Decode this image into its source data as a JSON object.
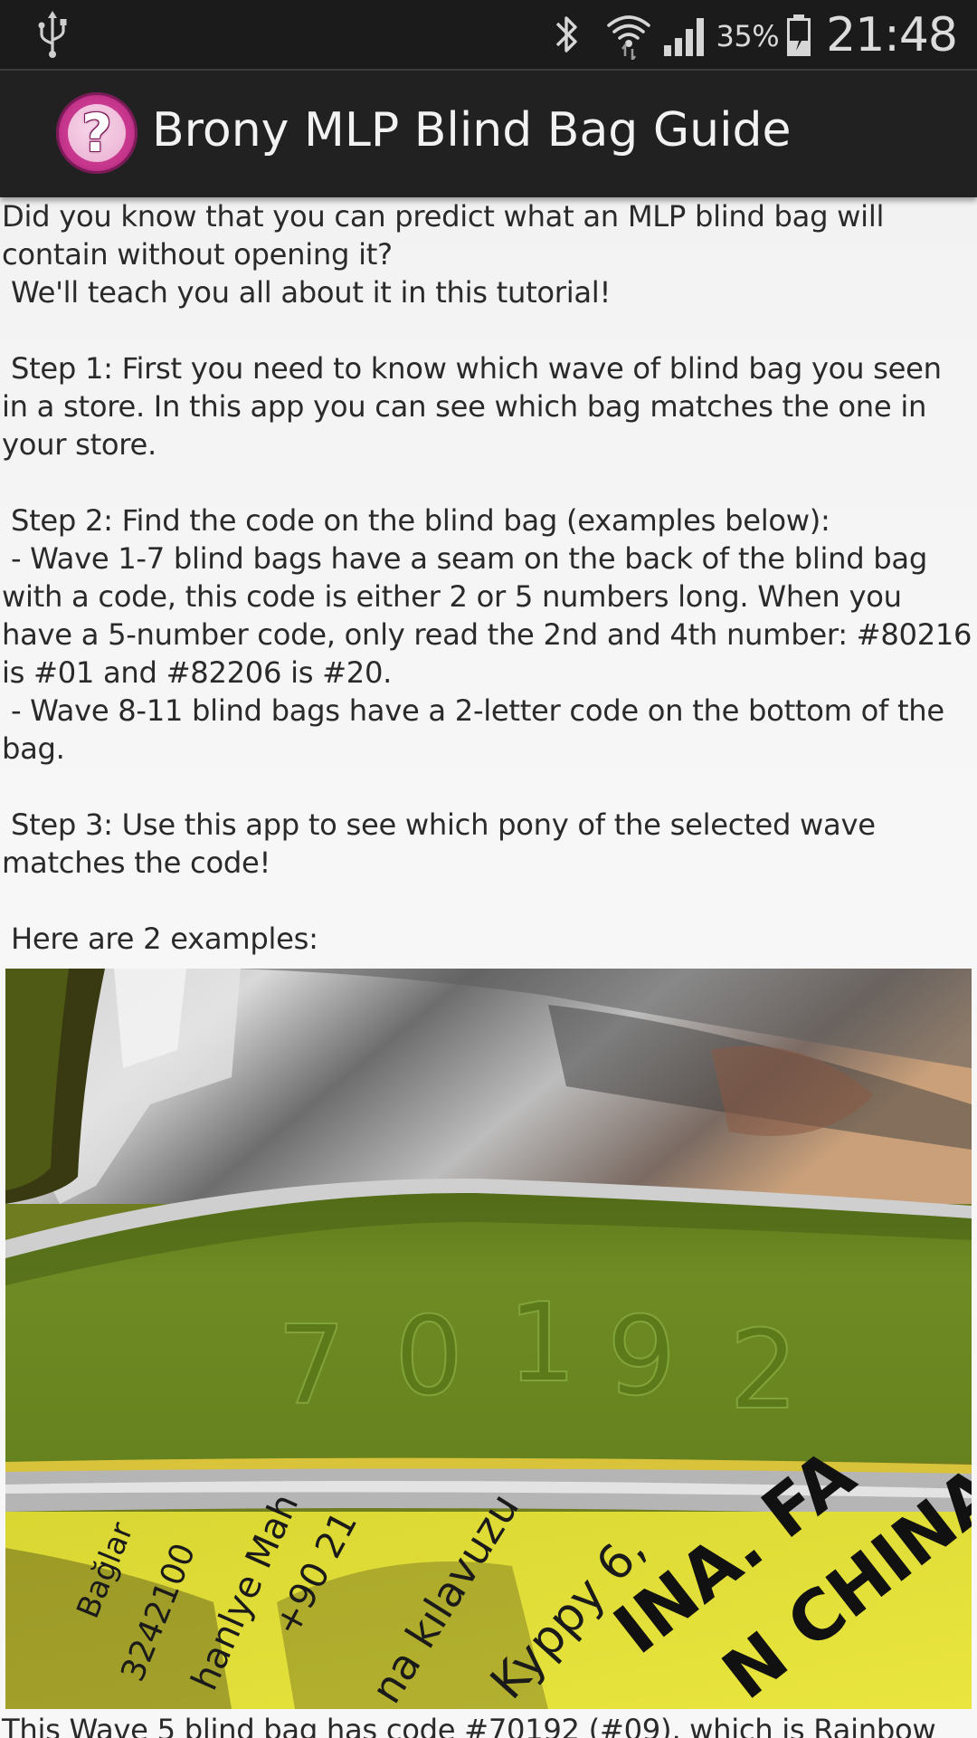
{
  "status_bar": {
    "icons": [
      "usb-icon",
      "bluetooth-icon",
      "wifi-icon",
      "signal-icon",
      "battery-charging-icon"
    ],
    "battery": "35%",
    "time": "21:48"
  },
  "action_bar": {
    "app_icon": "question-mark-icon",
    "title": "Brony MLP Blind Bag Guide"
  },
  "tutorial": {
    "text": "Did you know that you can predict what an MLP blind bag will contain without opening it?\n We'll teach you all about it in this tutorial!\n\n Step 1: First you need to know which wave of blind bag you seen in a store. In this app you can see which bag matches the one in your store.\n\n Step 2: Find the code on the blind bag (examples below):\n - Wave 1-7 blind bags have a seam on the back of the blind bag with a code, this code is either 2 or 5 numbers long. When you have a 5-number code, only read the 2nd and 4th number: #80216 is #01 and #82206 is #20.\n - Wave 8-11 blind bags have a 2-letter code on the bottom of the bag.\n\n Step 3: Use this app to see which pony of the selected wave matches the code!\n\n Here are 2 examples:"
  },
  "example_photo": {
    "embossed_code": "70192",
    "label_text_lines": [
      "INA. FA",
      "N CHINA",
      "Kyppy 6,",
      "na kılavuzu",
      "+90 21",
      "hanlye Mah",
      "Bağlar",
      "3242100"
    ],
    "colors": {
      "green_seam": "#6e8a22",
      "foil": "#b8b8b8",
      "label_yellow": "#e6e23a"
    }
  },
  "caption": {
    "text": "This Wave 5 blind bag has code #70192 (#09), which is Rainbow"
  }
}
